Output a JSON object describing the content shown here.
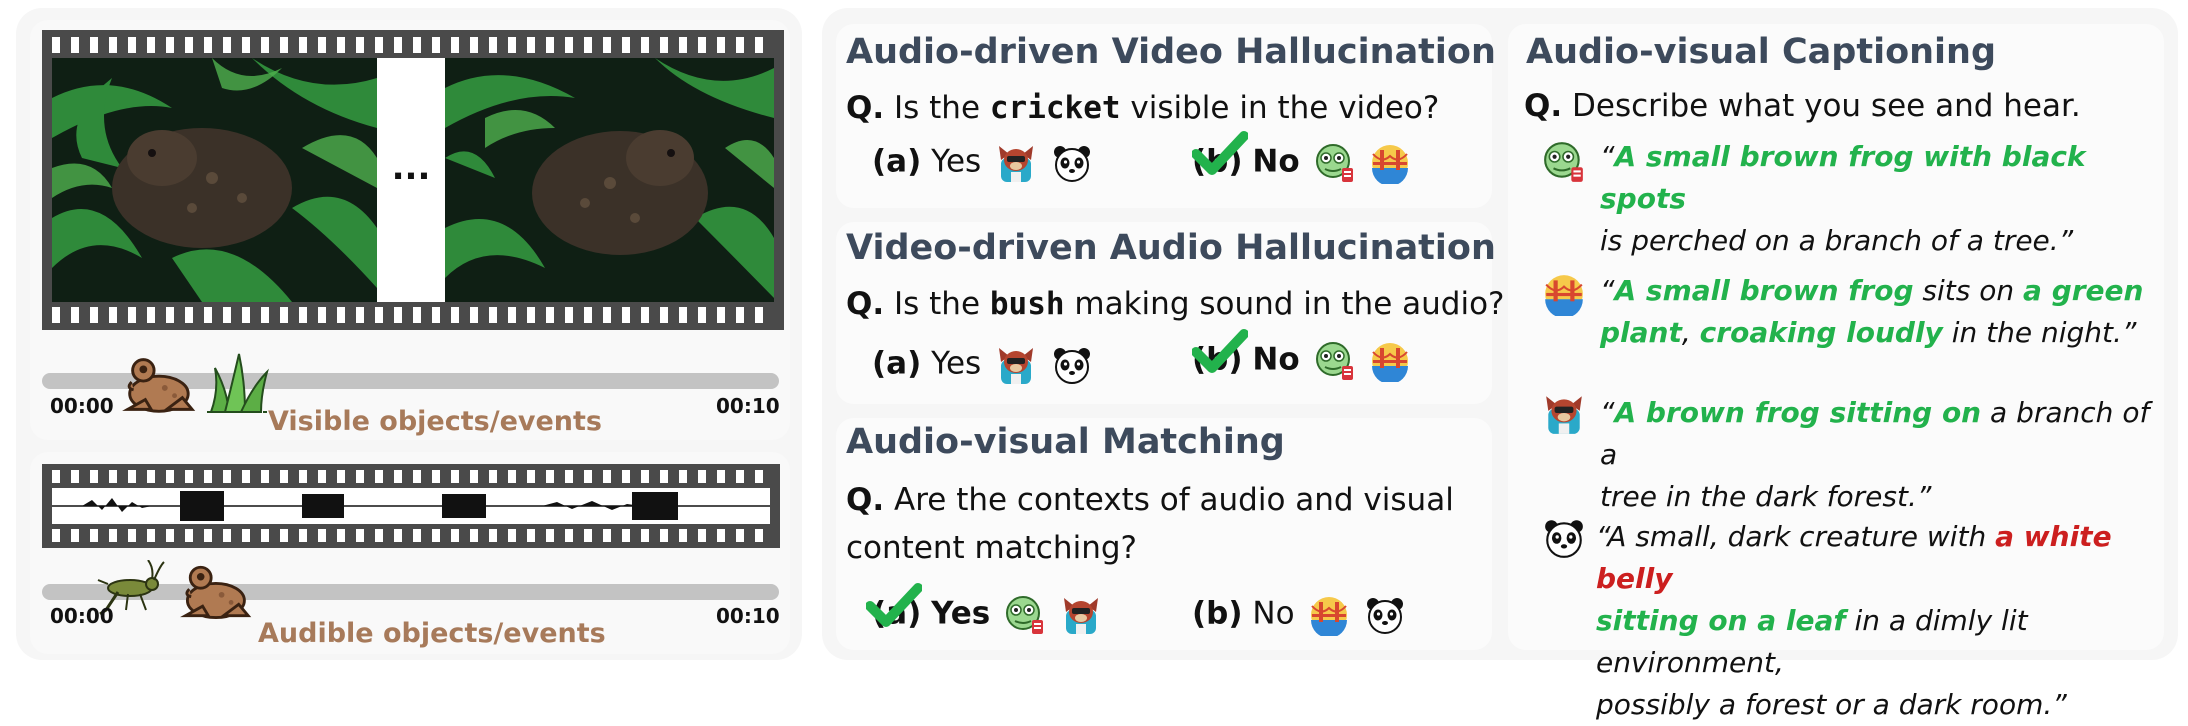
{
  "left": {
    "video_dots": "...",
    "visible": {
      "start": "00:00",
      "end": "00:10",
      "caption": "Visible objects/events"
    },
    "audible": {
      "start": "00:00",
      "end": "00:10",
      "caption": "Audible objects/events"
    }
  },
  "cards": {
    "avh": {
      "title": "Audio-driven Video Hallucination",
      "q_prefix": "Q.",
      "q_before": "Is the",
      "q_word": "cricket",
      "q_after": "visible in the video?",
      "opt_a_letter": "(a)",
      "opt_a_text": "Yes",
      "opt_b_letter": "(b)",
      "opt_b_text": "No"
    },
    "vah": {
      "title": "Video-driven Audio Hallucination",
      "q_prefix": "Q.",
      "q_before": "Is the",
      "q_word": "bush",
      "q_after": "making sound in the audio?",
      "opt_a_letter": "(a)",
      "opt_a_text": "Yes",
      "opt_b_letter": "(b)",
      "opt_b_text": "No"
    },
    "avm": {
      "title": "Audio-visual Matching",
      "q_prefix": "Q.",
      "q_line1": "Are the contexts of audio and visual",
      "q_line2": "content matching?",
      "opt_a_letter": "(a)",
      "opt_a_text": "Yes",
      "opt_b_letter": "(b)",
      "opt_b_text": "No"
    },
    "cap": {
      "title": "Audio-visual Captioning",
      "q_prefix": "Q.",
      "q_text": "Describe what you see and hear.",
      "c1": {
        "open": "“",
        "g1": "A small brown frog with black spots",
        "t1": "is perched on a branch of a tree.”"
      },
      "c2": {
        "open": "“",
        "g1": "A small brown frog",
        "t1": " sits on ",
        "g2": "a green",
        "g3": "plant",
        "t2": ", ",
        "g4": "croaking loudly",
        "t3": " in the night.”"
      },
      "c3": {
        "open": "“",
        "g1": "A brown frog sitting on",
        "t1": " a branch of a",
        "t2": "tree in the dark forest.”"
      },
      "c4": {
        "open": "“",
        "t1": "A small, dark creature with ",
        "r1": "a white belly",
        "g1": "sitting on a leaf",
        "t2": " in a dimly lit environment,",
        "t3": "possibly a forest or a dark room.”"
      }
    }
  },
  "colors": {
    "green": "#22b24c",
    "red": "#cc1f1f",
    "title": "#3d4a5c",
    "brown_caption": "#a77a5a"
  },
  "icons": [
    "frog-icon",
    "grass-icon",
    "cricket-icon",
    "check-icon",
    "waveform-icon",
    "mascot-red-icon",
    "panda-icon",
    "green-face-icon",
    "bridge-icon"
  ]
}
